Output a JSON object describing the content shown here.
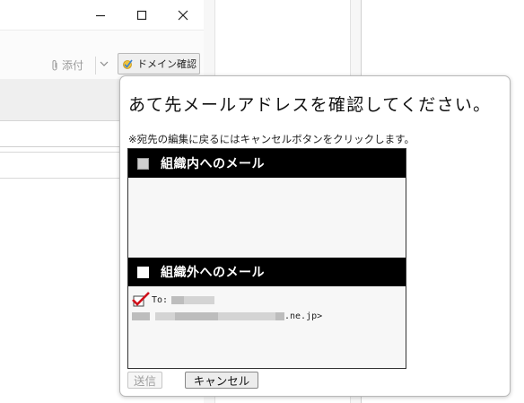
{
  "window": {
    "controls": [
      "minimize-icon",
      "maximize-icon",
      "close-icon"
    ]
  },
  "toolbar": {
    "attach_label": "添付",
    "domain_check_label": "ドメイン確認"
  },
  "dialog": {
    "title": "あて先メールアドレスを確認してください。",
    "note": "※宛先の編集に戻るにはキャンセルボタンをクリックします。",
    "internal_section": {
      "label": "組織内へのメール",
      "recipients": []
    },
    "external_section": {
      "label": "組織外へのメール",
      "recipient_prefix": "To:",
      "recipient_suffix": ".ne.jp>"
    },
    "send_label": "送信",
    "cancel_label": "キャンセル"
  },
  "colors": {
    "section_header_bg": "#000000",
    "list_bg": "#f7f7f7",
    "check_red": "#d0101a"
  }
}
